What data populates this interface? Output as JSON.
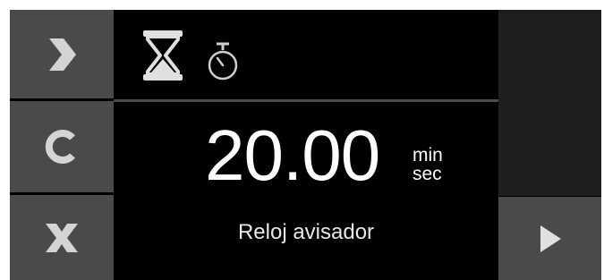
{
  "timer": {
    "value": "20.00",
    "unit_top": "min",
    "unit_bottom": "sec",
    "label": "Reloj avisador"
  },
  "left_buttons": [
    {
      "icon": "chevron-right-icon"
    },
    {
      "icon": "clear-c-icon"
    },
    {
      "icon": "close-x-icon"
    }
  ],
  "modes": [
    {
      "icon": "hourglass-icon",
      "selected": true
    },
    {
      "icon": "stopwatch-icon",
      "selected": false
    }
  ],
  "right_button": {
    "icon": "play-icon"
  },
  "colors": {
    "panel": "#000000",
    "button": "#4a4a4a",
    "icon": "#d4d4d4",
    "text": "#ffffff",
    "right_panel": "#1f1f1f"
  }
}
